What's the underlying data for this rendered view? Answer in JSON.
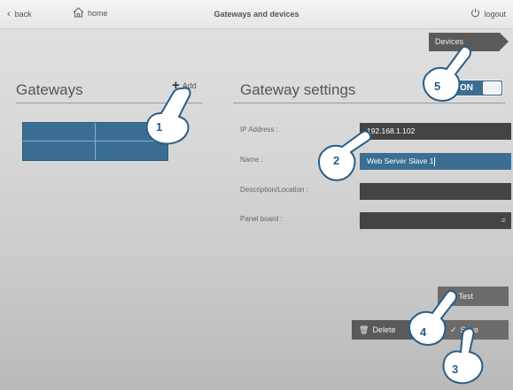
{
  "topbar": {
    "back_label": "back",
    "home_label": "home",
    "title": "Gateways and devices",
    "logout_label": "logout"
  },
  "devices_tab": {
    "label": "Devices"
  },
  "gateways": {
    "title": "Gateways",
    "add_label": "Add"
  },
  "settings": {
    "title": "Gateway settings",
    "toggle_label": "ON",
    "toggle_state": "on",
    "fields": {
      "ip": {
        "label": "IP Address :",
        "value": "192.168.1.102"
      },
      "name": {
        "label": "Name :",
        "value": "Web Server Slave 1"
      },
      "description": {
        "label": "Description/Location :",
        "value": ""
      },
      "panel": {
        "label": "Panel board :",
        "value": ""
      }
    }
  },
  "buttons": {
    "test": "Test",
    "delete": "Delete",
    "save": "Save"
  },
  "callouts": {
    "c1": "1",
    "c2": "2",
    "c3": "3",
    "c4": "4",
    "c5": "5"
  },
  "colors": {
    "accent": "#3b6e92",
    "field_dark": "#444444",
    "button_gray": "#6b6b6b"
  }
}
